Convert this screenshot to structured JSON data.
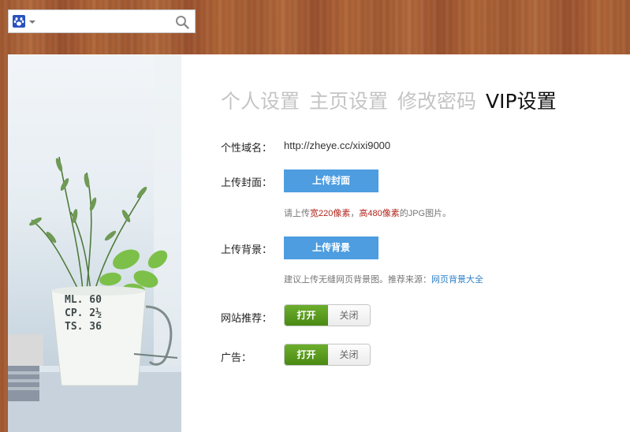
{
  "search": {
    "value": "",
    "placeholder": ""
  },
  "tabs": [
    {
      "label": "个人设置",
      "active": false
    },
    {
      "label": "主页设置",
      "active": false
    },
    {
      "label": "修改密码",
      "active": false
    },
    {
      "label": "VIP设置",
      "active": true
    }
  ],
  "domain": {
    "label": "个性域名：",
    "value": "http://zheye.cc/xixi9000"
  },
  "cover": {
    "label": "上传封面：",
    "button": "上传封面",
    "hint": {
      "prefix": "请上传",
      "width": "宽220像素",
      "sep": "，",
      "height": "高480像素",
      "suffix": "的JPG图片。"
    }
  },
  "background": {
    "label": "上传背景：",
    "button": "上传背景",
    "hint": {
      "text": "建议上传无缝网页背景图。推荐来源：",
      "link": "网页背景大全"
    }
  },
  "recommend": {
    "label": "网站推荐：",
    "on": "打开",
    "off": "关闭"
  },
  "ads": {
    "label": "广告：",
    "on": "打开",
    "off": "关闭"
  },
  "pot_text": {
    "line1": "ML. 60",
    "line2": "CP. 2½",
    "line3": "TS. 36"
  },
  "colors": {
    "accent": "#4d9de0",
    "toggle_on": "#5a9a1e",
    "wood": "#a85f36",
    "link": "#2f80c8",
    "highlight": "#b3261e"
  }
}
